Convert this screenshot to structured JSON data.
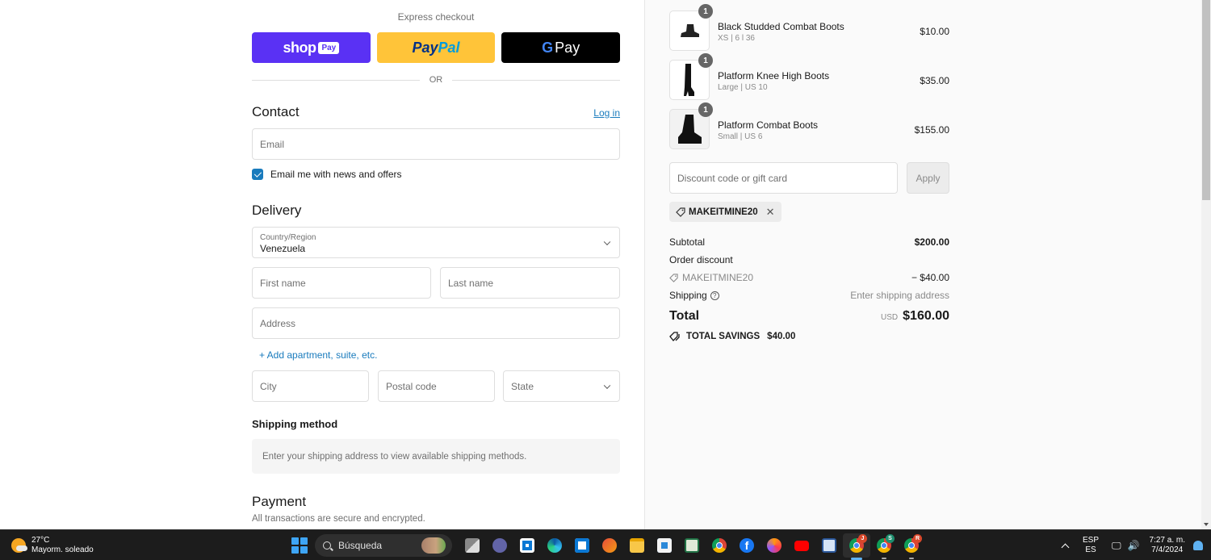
{
  "express": {
    "title": "Express checkout",
    "shop_pay": {
      "word": "shop",
      "pill": "Pay"
    },
    "paypal": {
      "part1": "Pay",
      "part2": "Pal"
    },
    "gpay": {
      "g": "G",
      "label": "Pay"
    },
    "or_label": "OR"
  },
  "contact": {
    "title": "Contact",
    "login_link": "Log in",
    "email_placeholder": "Email",
    "email_value": "",
    "newsletter_label": "Email me with news and offers",
    "newsletter_checked": true
  },
  "delivery": {
    "title": "Delivery",
    "country_label": "Country/Region",
    "country_value": "Venezuela",
    "first_name_placeholder": "First name",
    "last_name_placeholder": "Last name",
    "address_placeholder": "Address",
    "add_apartment": "+ Add apartment, suite, etc.",
    "city_placeholder": "City",
    "postal_placeholder": "Postal code",
    "state_label": "State"
  },
  "shipping_method": {
    "title": "Shipping method",
    "message": "Enter your shipping address to view available shipping methods."
  },
  "payment": {
    "title": "Payment",
    "subtitle": "All transactions are secure and encrypted."
  },
  "order": {
    "items": [
      {
        "qty": "1",
        "name": "Black Studded Combat Boots",
        "variant": "XS | 6 l 36",
        "price": "$10.00"
      },
      {
        "qty": "1",
        "name": "Platform Knee High Boots",
        "variant": "Large | US 10",
        "price": "$35.00"
      },
      {
        "qty": "1",
        "name": "Platform Combat Boots",
        "variant": "Small | US 6",
        "price": "$155.00"
      }
    ],
    "discount_placeholder": "Discount code or gift card",
    "apply_label": "Apply",
    "applied_code": "MAKEITMINE20",
    "subtotal_label": "Subtotal",
    "subtotal_value": "$200.00",
    "order_discount_label": "Order discount",
    "discount_code": "MAKEITMINE20",
    "discount_value": "− $40.00",
    "shipping_label": "Shipping",
    "shipping_value": "Enter shipping address",
    "total_label": "Total",
    "currency": "USD",
    "total_value": "$160.00",
    "savings_label": "TOTAL SAVINGS",
    "savings_value": "$40.00"
  },
  "taskbar": {
    "weather_temp": "27°C",
    "weather_desc": "Mayorm. soleado",
    "search_label": "Búsqueda",
    "badges": {
      "chrome1": "J",
      "chrome2": "S",
      "chrome3": "R"
    },
    "lang_top": "ESP",
    "lang_bottom": "ES",
    "time": "7:27 a. m.",
    "date": "7/4/2024"
  },
  "colors": {
    "shop_pay": "#5a31f4",
    "paypal": "#ffc439",
    "gpay": "#000000",
    "link": "#197bbd"
  }
}
